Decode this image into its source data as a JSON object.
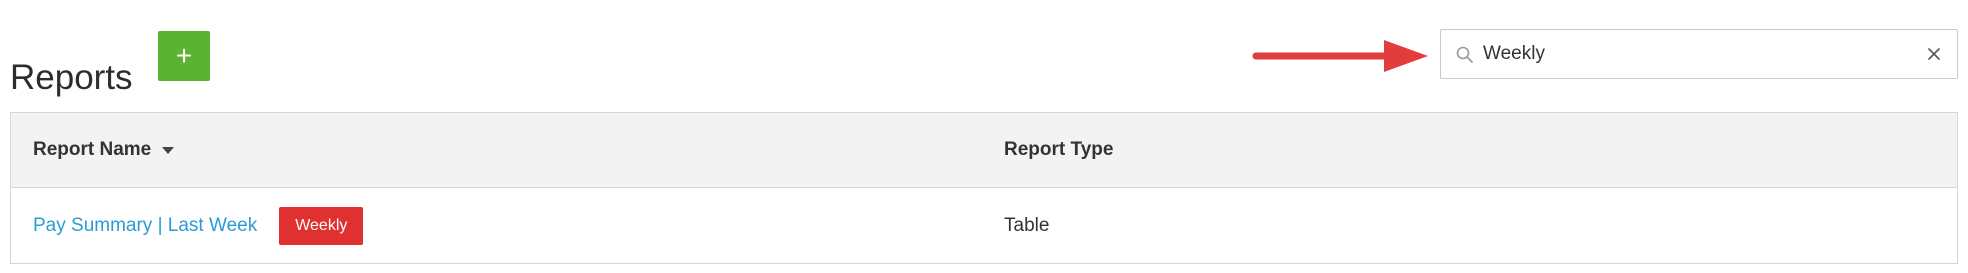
{
  "page": {
    "title": "Reports"
  },
  "toolbar": {
    "add_label": "+"
  },
  "search": {
    "value": "Weekly",
    "placeholder": ""
  },
  "colors": {
    "add_button": "#5bb233",
    "badge": "#e03030",
    "link": "#2b9bd6",
    "annotation_arrow": "#e33c3c"
  },
  "table": {
    "columns": [
      {
        "label": "Report Name",
        "sortable": true,
        "sort": "descending"
      },
      {
        "label": "Report Type"
      }
    ],
    "rows": [
      {
        "name": "Pay Summary | Last Week",
        "badge": "Weekly",
        "type": "Table"
      }
    ]
  }
}
